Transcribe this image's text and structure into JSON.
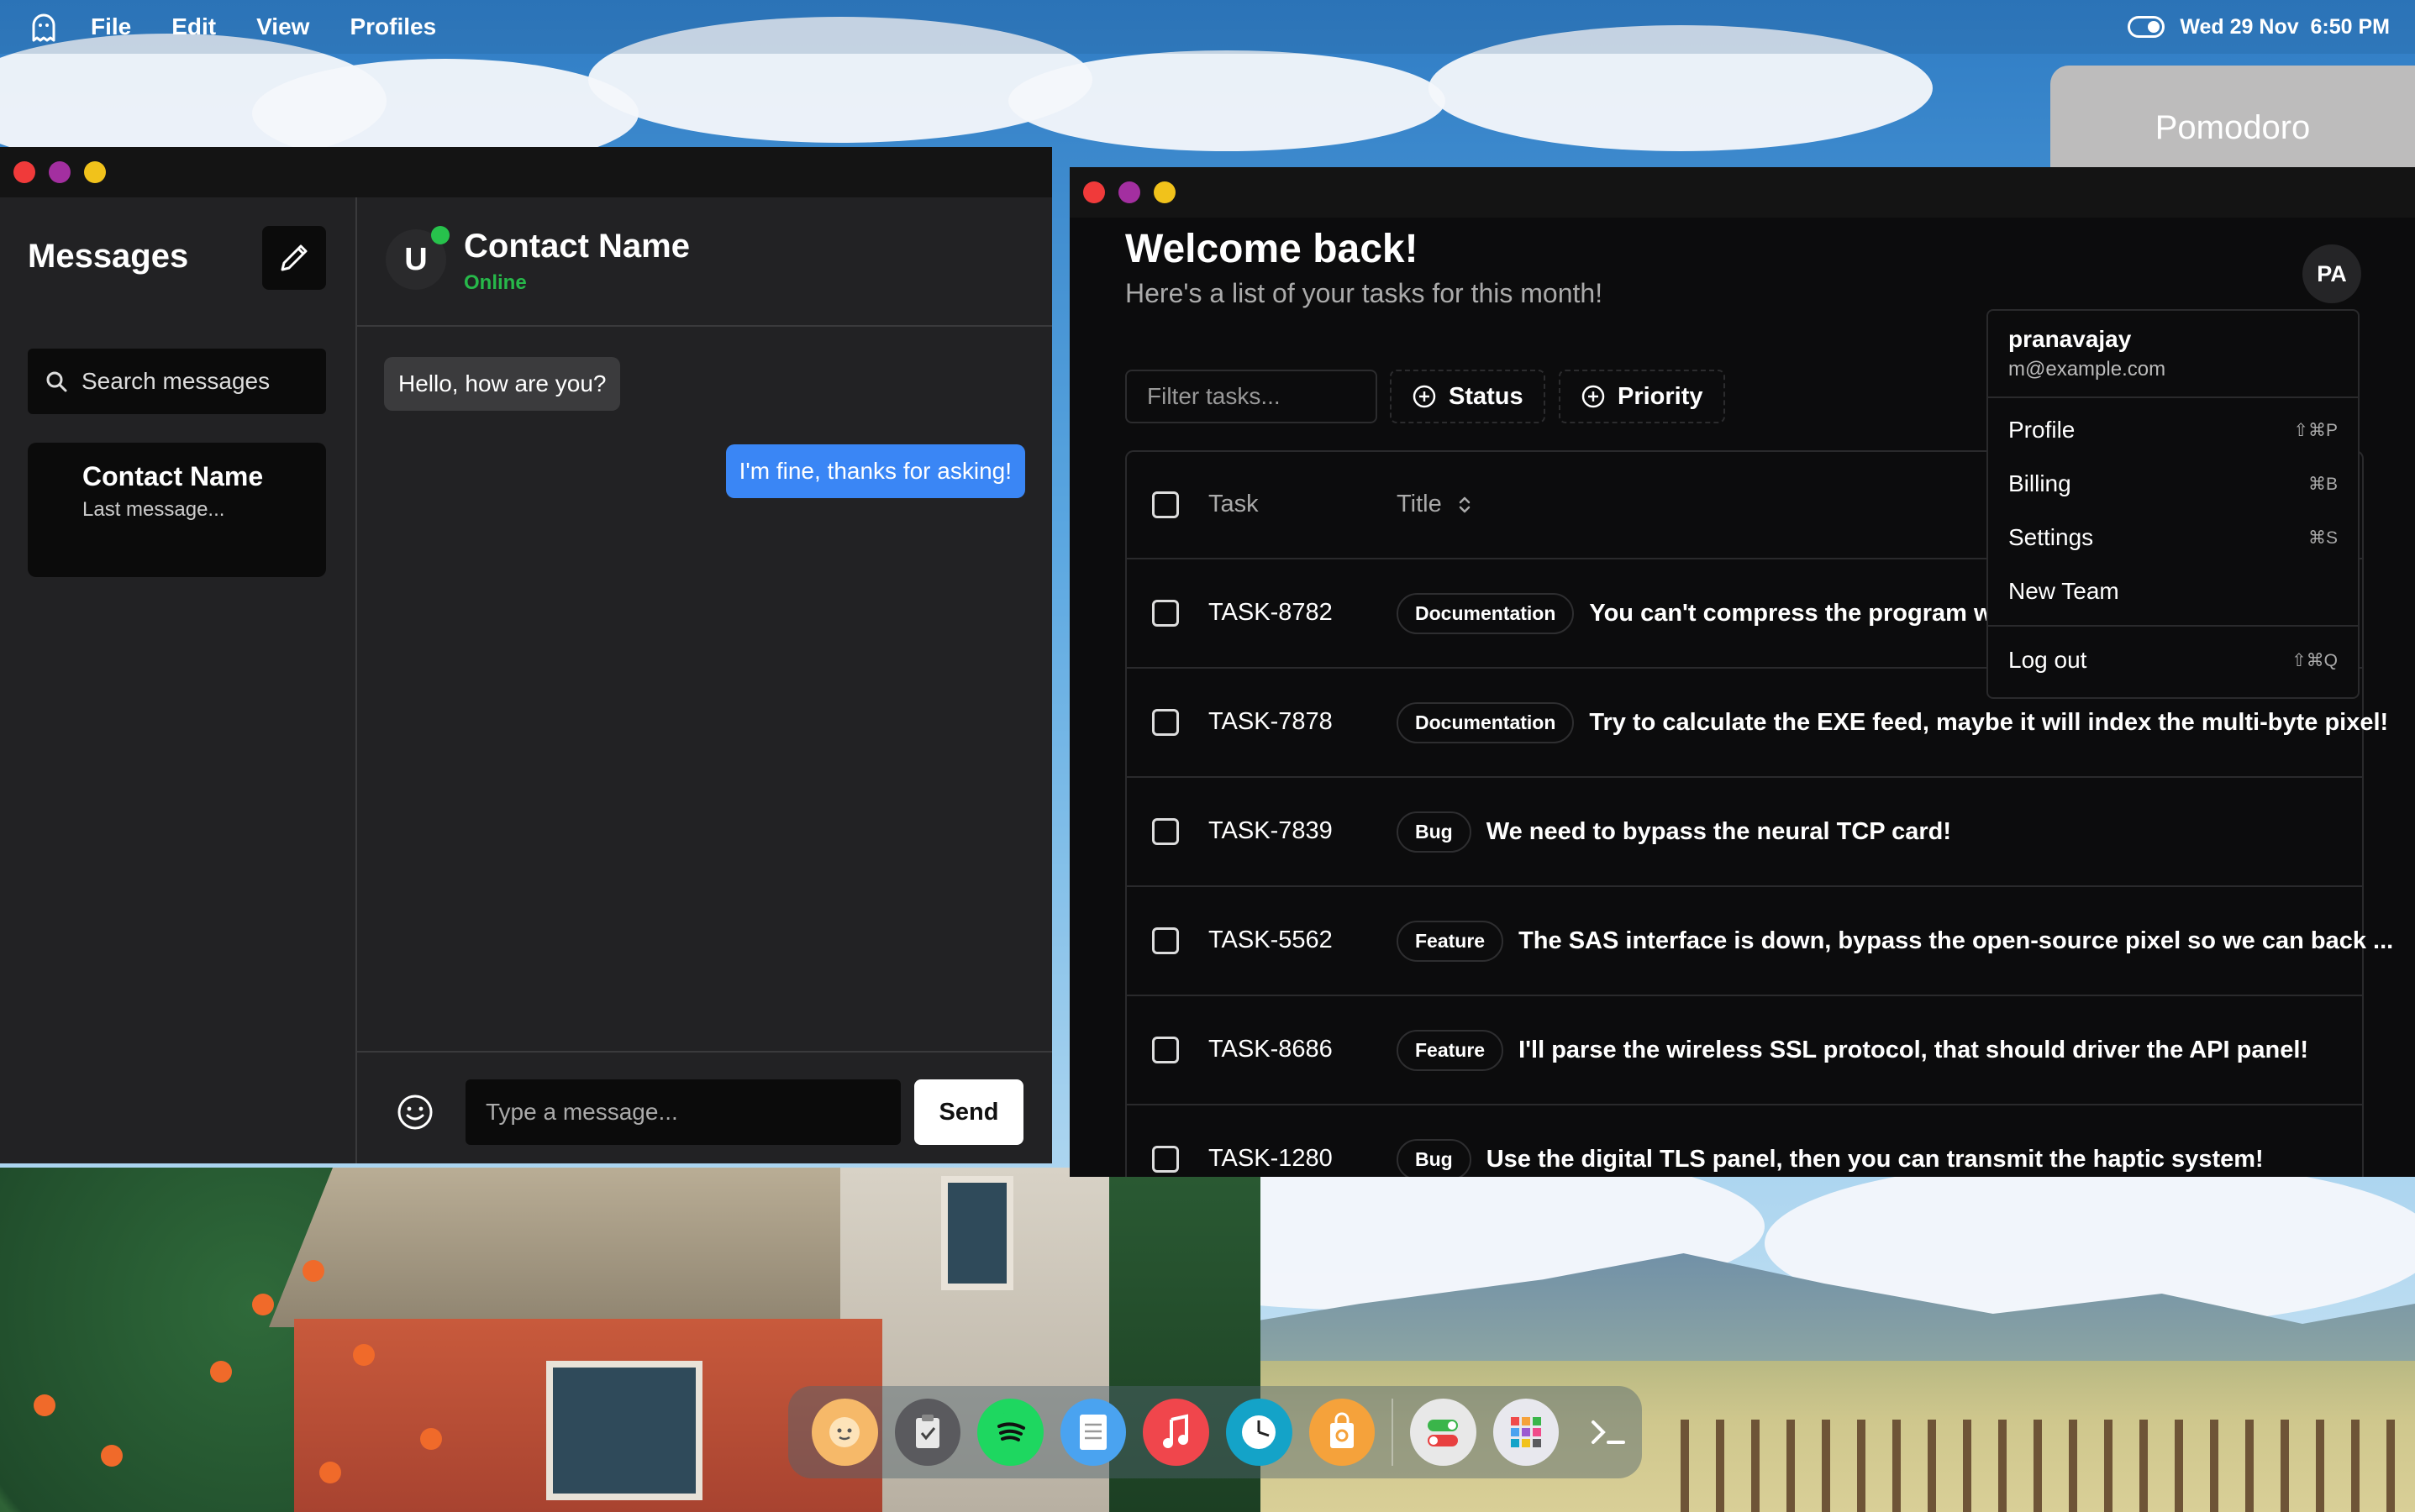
{
  "menubar": {
    "items": [
      "File",
      "Edit",
      "View",
      "Profiles"
    ],
    "datetime": "Wed 29 Nov  6:50 PM"
  },
  "pomodoro": {
    "label": "Pomodoro"
  },
  "messages_app": {
    "title": "Messages",
    "search_placeholder": "Search messages",
    "contact_card": {
      "name": "Contact Name",
      "last_message": "Last message..."
    },
    "chat": {
      "avatar_initial": "U",
      "contact_name": "Contact Name",
      "status": "Online",
      "messages": [
        {
          "from": "them",
          "text": "Hello, how are you?"
        },
        {
          "from": "me",
          "text": "I'm fine, thanks for asking!"
        }
      ],
      "input_placeholder": "Type a message...",
      "send_label": "Send"
    }
  },
  "tasks_app": {
    "heading": "Welcome back!",
    "subheading": "Here's a list of your tasks for this month!",
    "avatar_initials": "PA",
    "filter_placeholder": "Filter tasks...",
    "filter_chips": [
      "Status",
      "Priority"
    ],
    "columns": [
      "Task",
      "Title"
    ],
    "rows": [
      {
        "id": "TASK-8782",
        "label": "Documentation",
        "title": "You can't compress the program wi"
      },
      {
        "id": "TASK-7878",
        "label": "Documentation",
        "title": "Try to calculate the EXE feed, maybe it will index the multi-byte pixel!"
      },
      {
        "id": "TASK-7839",
        "label": "Bug",
        "title": "We need to bypass the neural TCP card!"
      },
      {
        "id": "TASK-5562",
        "label": "Feature",
        "title": "The SAS interface is down, bypass the open-source pixel so we can back ..."
      },
      {
        "id": "TASK-8686",
        "label": "Feature",
        "title": "I'll parse the wireless SSL protocol, that should driver the API panel!"
      },
      {
        "id": "TASK-1280",
        "label": "Bug",
        "title": "Use the digital TLS panel, then you can transmit the haptic system!"
      }
    ],
    "user_menu": {
      "username": "pranavajay",
      "email": "m@example.com",
      "items": [
        {
          "label": "Profile",
          "shortcut": "⇧⌘P"
        },
        {
          "label": "Billing",
          "shortcut": "⌘B"
        },
        {
          "label": "Settings",
          "shortcut": "⌘S"
        },
        {
          "label": "New Team",
          "shortcut": ""
        }
      ],
      "logout": {
        "label": "Log out",
        "shortcut": "⇧⌘Q"
      }
    }
  },
  "dock": {
    "apps": [
      "finder-icon",
      "clipboard-icon",
      "spotify-icon",
      "notes-icon",
      "music-icon",
      "clock-icon",
      "store-icon",
      "toggles-icon",
      "launchpad-icon",
      "terminal-icon"
    ]
  },
  "colors": {
    "accent_blue": "#3a86f5",
    "online_green": "#27c24c",
    "window_bg": "#1f1f21",
    "tasks_bg": "#0c0c0d",
    "close": "#f03a3a",
    "minimize": "#a32fa0",
    "maximize": "#f1c21b"
  }
}
